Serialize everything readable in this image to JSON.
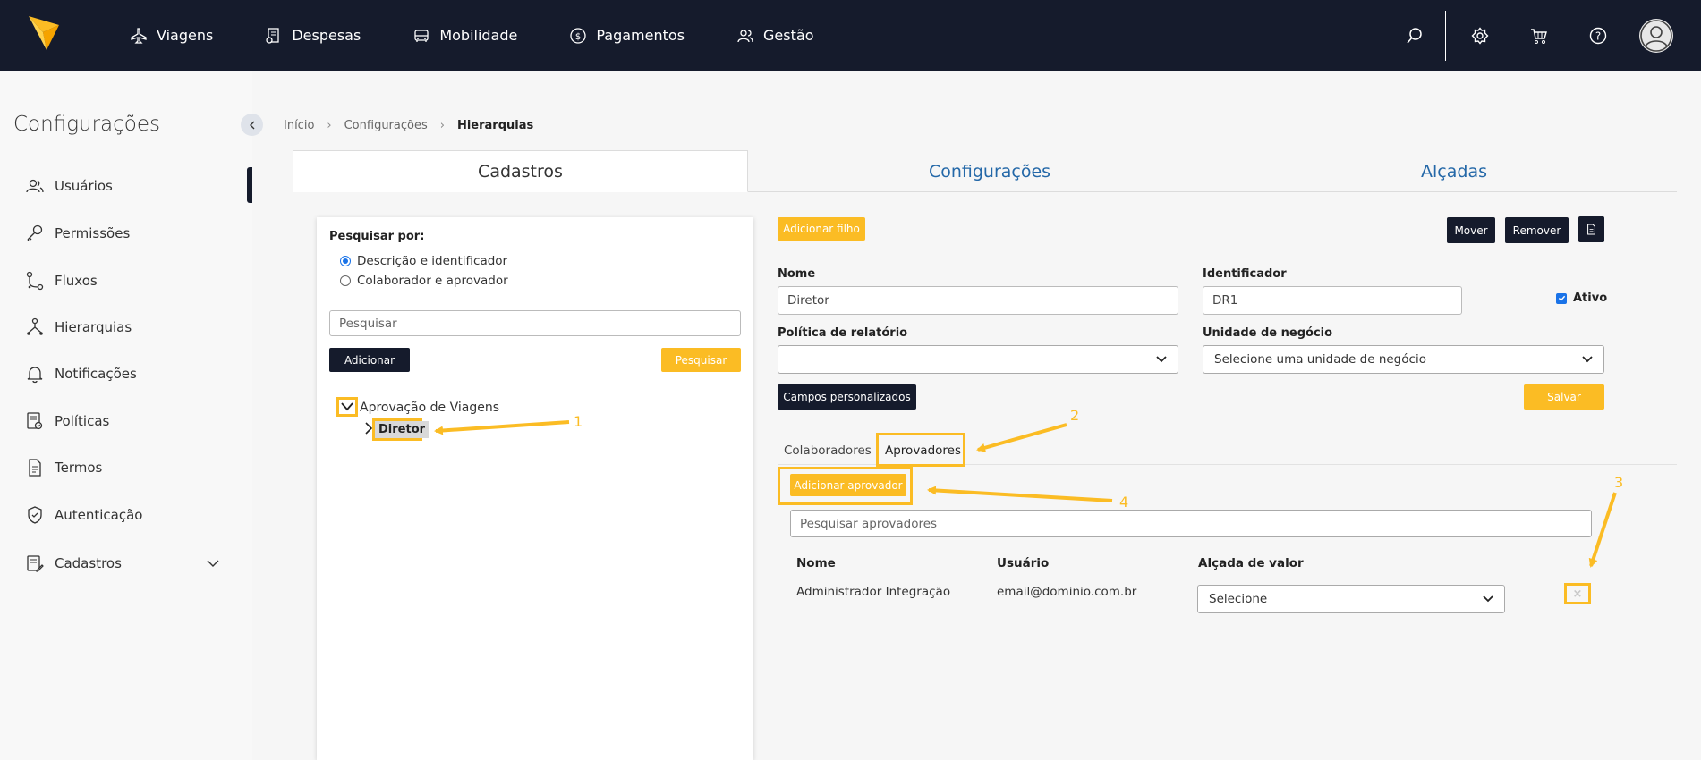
{
  "brand": {
    "accent": "#fbbc24",
    "navbar": "#151b2c",
    "link": "#2468a8"
  },
  "topnav": {
    "items": [
      {
        "label": "Viagens",
        "icon": "plane-icon"
      },
      {
        "label": "Despesas",
        "icon": "receipt-icon"
      },
      {
        "label": "Mobilidade",
        "icon": "car-icon"
      },
      {
        "label": "Pagamentos",
        "icon": "dollar-icon"
      },
      {
        "label": "Gestão",
        "icon": "users-icon"
      }
    ],
    "icons": [
      "search-icon",
      "gear-icon",
      "cart-icon",
      "help-icon",
      "avatar-icon"
    ]
  },
  "sidebar": {
    "title": "Configurações",
    "items": [
      {
        "label": "Usuários",
        "icon": "users-icon"
      },
      {
        "label": "Permissões",
        "icon": "key-icon"
      },
      {
        "label": "Fluxos",
        "icon": "flow-icon"
      },
      {
        "label": "Hierarquias",
        "icon": "hierarchy-icon"
      },
      {
        "label": "Notificações",
        "icon": "bell-icon"
      },
      {
        "label": "Políticas",
        "icon": "policy-icon"
      },
      {
        "label": "Termos",
        "icon": "document-icon"
      },
      {
        "label": "Autenticação",
        "icon": "shield-icon"
      },
      {
        "label": "Cadastros",
        "icon": "register-icon"
      }
    ]
  },
  "breadcrumb": {
    "home": "Início",
    "section": "Configurações",
    "current": "Hierarquias"
  },
  "main_tabs": {
    "cadastros": "Cadastros",
    "configuracoes": "Configurações",
    "alcadas": "Alçadas"
  },
  "search_panel": {
    "label": "Pesquisar por:",
    "options": [
      "Descrição e identificador",
      "Colaborador e aprovador"
    ],
    "selected_option": "Descrição e identificador",
    "search_placeholder": "Pesquisar",
    "add_label": "Adicionar",
    "search_label": "Pesquisar"
  },
  "tree": {
    "root": "Aprovação de Viagens",
    "child": "Diretor"
  },
  "form": {
    "add_child_label": "Adicionar filho",
    "move_label": "Mover",
    "remove_label": "Remover",
    "name_label": "Nome",
    "name_value": "Diretor",
    "identifier_label": "Identificador",
    "identifier_value": "DR1",
    "active_label": "Ativo",
    "active": true,
    "policy_label": "Política de relatório",
    "policy_value": "",
    "business_unit_label": "Unidade de negócio",
    "business_unit_value": "Selecione uma unidade de negócio",
    "custom_fields_label": "Campos personalizados",
    "save_label": "Salvar"
  },
  "sub_tabs": {
    "collaborators": "Colaboradores",
    "approvers": "Aprovadores"
  },
  "approvers": {
    "add_label": "Adicionar aprovador",
    "search_placeholder": "Pesquisar aprovadores",
    "columns": {
      "name": "Nome",
      "user": "Usuário",
      "value_level": "Alçada de valor"
    },
    "rows": [
      {
        "name": "Administrador Integração",
        "user": "email@dominio.com.br",
        "value_level": "Selecione",
        "remove": "×"
      }
    ]
  },
  "annotations": {
    "n1": "1",
    "n2": "2",
    "n3": "3",
    "n4": "4"
  }
}
